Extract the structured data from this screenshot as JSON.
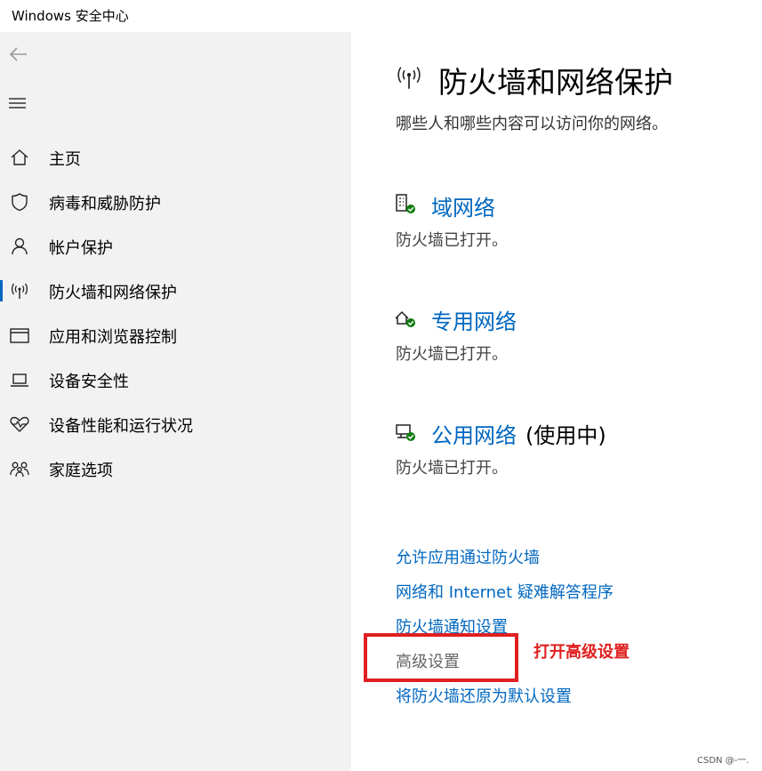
{
  "window": {
    "title": "Windows 安全中心"
  },
  "sidebar": {
    "back_icon": "back-arrow-icon",
    "menu_icon": "hamburger-menu-icon",
    "items": [
      {
        "label": "主页",
        "icon": "home-icon",
        "active": false
      },
      {
        "label": "病毒和威胁防护",
        "icon": "shield-icon",
        "active": false
      },
      {
        "label": "帐户保护",
        "icon": "person-icon",
        "active": false
      },
      {
        "label": "防火墙和网络保护",
        "icon": "wifi-antenna-icon",
        "active": true
      },
      {
        "label": "应用和浏览器控制",
        "icon": "browser-window-icon",
        "active": false
      },
      {
        "label": "设备安全性",
        "icon": "laptop-icon",
        "active": false
      },
      {
        "label": "设备性能和运行状况",
        "icon": "heart-pulse-icon",
        "active": false
      },
      {
        "label": "家庭选项",
        "icon": "family-icon",
        "active": false
      }
    ]
  },
  "main": {
    "title": "防火墙和网络保护",
    "subtitle": "哪些人和哪些内容可以访问你的网络。",
    "networks": [
      {
        "name": "域网络",
        "suffix": "",
        "status": "防火墙已打开。",
        "icon": "domain-network-icon"
      },
      {
        "name": "专用网络",
        "suffix": "",
        "status": "防火墙已打开。",
        "icon": "private-network-icon"
      },
      {
        "name": "公用网络",
        "suffix": "(使用中)",
        "status": "防火墙已打开。",
        "icon": "public-network-icon"
      }
    ],
    "links": [
      {
        "label": "允许应用通过防火墙"
      },
      {
        "label": "网络和 Internet 疑难解答程序"
      },
      {
        "label": "防火墙通知设置"
      },
      {
        "label": "高级设置"
      },
      {
        "label": "将防火墙还原为默认设置"
      }
    ]
  },
  "annotation": {
    "text": "打开高级设置"
  },
  "watermark": "CSDN @-一.",
  "colors": {
    "accent": "#0067c0",
    "sidebar_bg": "#f2f2f2",
    "annotation_red": "#e02020",
    "status_green": "#107c10"
  }
}
